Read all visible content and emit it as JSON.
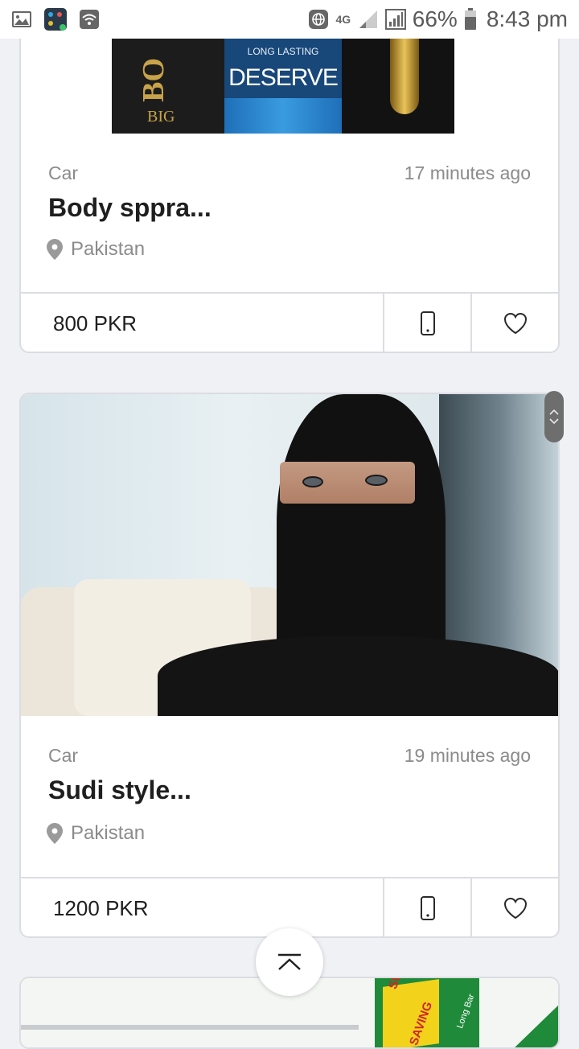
{
  "status_bar": {
    "network": "4G",
    "battery_percent": "66%",
    "time": "8:43 pm"
  },
  "listings": [
    {
      "category": "Car",
      "time_ago": "17 minutes ago",
      "title": "Body sppra...",
      "location": "Pakistan",
      "price": "800 PKR",
      "image_text": {
        "left_brand": "BO",
        "left_sub": "BIG",
        "center_top": "LONG LASTING",
        "center_brand": "DESERVE"
      }
    },
    {
      "category": "Car",
      "time_ago": "19 minutes ago",
      "title": "Sudi style...",
      "location": "Pakistan",
      "price": "1200 PKR"
    },
    {
      "image_text": {
        "badge_line1": "SUPER",
        "badge_line2": "SAVING",
        "side": "Long Bar"
      }
    }
  ],
  "colors": {
    "background": "#f0f1f5",
    "card": "#ffffff",
    "border": "#dcdde2",
    "muted_text": "#8b8b8b",
    "primary_text": "#1f1f1f"
  }
}
